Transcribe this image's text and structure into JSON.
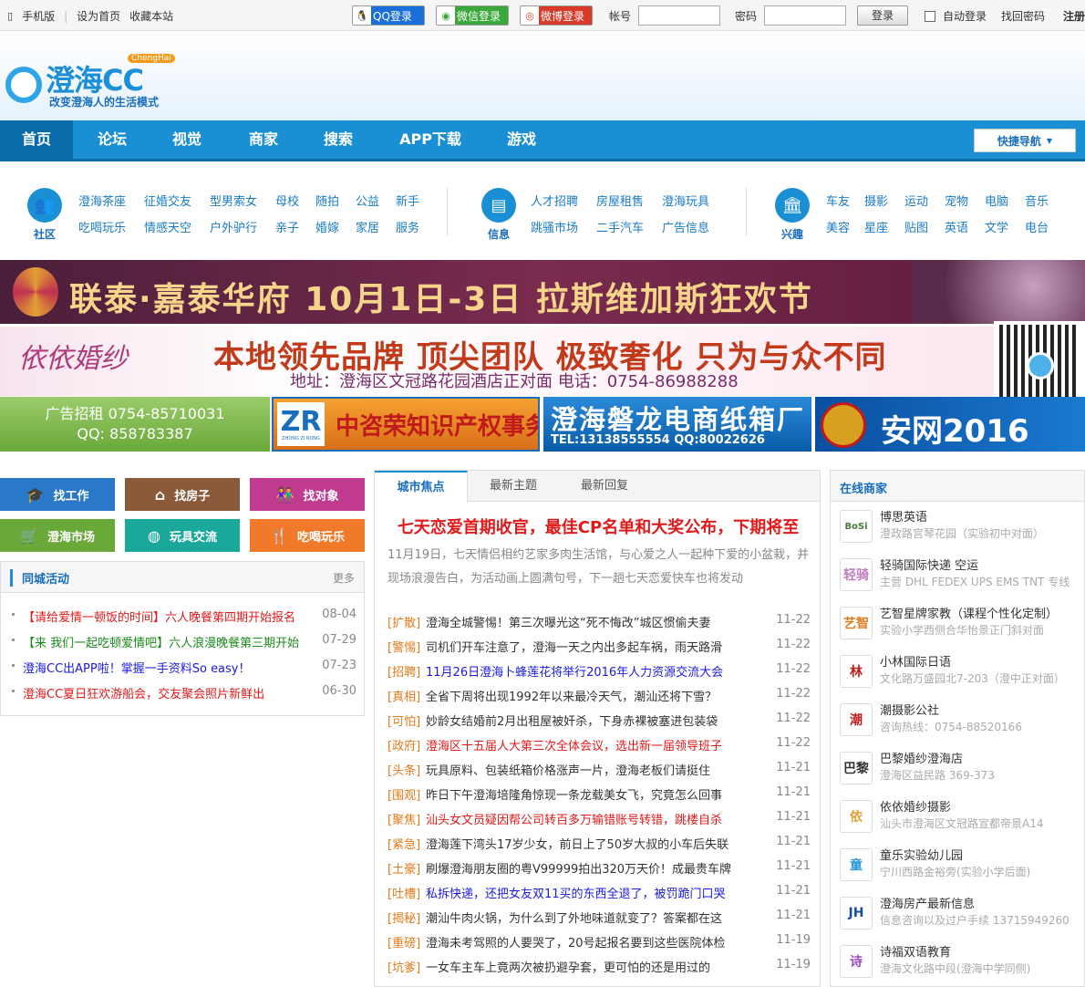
{
  "topbar": {
    "mobile": "手机版",
    "set_home": "设为首页",
    "bookmark": "收藏本站",
    "qq_login": "QQ登录",
    "wechat_login": "微信登录",
    "weibo_login": "微博登录",
    "account_label": "帐号",
    "password_label": "密码",
    "login_button": "登录",
    "auto_login": "自动登录",
    "forgot": "找回密码",
    "register": "注册"
  },
  "header": {
    "logo_text": "澄海CC",
    "logo_en": "ChengHai",
    "slogan": "改变澄海人的生活模式"
  },
  "nav": {
    "items": [
      "首页",
      "论坛",
      "视觉",
      "商家",
      "搜索",
      "APP下载",
      "游戏"
    ],
    "quick_nav": "快捷导航"
  },
  "categories": {
    "community": {
      "label": "社区",
      "links": [
        "澄海茶座",
        "征婚交友",
        "型男索女",
        "母校",
        "随拍",
        "公益",
        "新手",
        "吃喝玩乐",
        "情感天空",
        "户外驴行",
        "亲子",
        "婚嫁",
        "家居",
        "服务"
      ]
    },
    "info": {
      "label": "信息",
      "links": [
        "人才招聘",
        "房屋租售",
        "澄海玩具",
        "跳骚市场",
        "二手汽车",
        "广告信息"
      ]
    },
    "interest": {
      "label": "兴趣",
      "links": [
        "车友",
        "摄影",
        "运动",
        "宠物",
        "电脑",
        "音乐",
        "美容",
        "星座",
        "贴图",
        "英语",
        "文学",
        "电台"
      ]
    }
  },
  "banners": {
    "b1": "联泰·嘉泰华府  10月1日-3日  拉斯维加斯狂欢节",
    "b2_brand": "依依婚纱",
    "b2_main": "本地领先品牌  顶尖团队  极致奢化  只为与众不同",
    "b2_sub": "地址：澄海区文冠路花园酒店正对面   电话：0754-86988288",
    "ad1_line1": "广告招租 0754-85710031",
    "ad1_line2": "QQ: 858783387",
    "ad2_logo": "ZR",
    "ad2_logo_text": "ZHONG ZI RONG",
    "ad2_title": "中咨荣知识产权事务所",
    "ad3_title": "澄海磐龙电商纸箱厂",
    "ad3_sub": "TEL:13138555554   QQ:80022626",
    "ad4_title": "安网2016"
  },
  "tiles": [
    {
      "label": "找工作",
      "icon": "graduation-cap-icon",
      "glyph": "🎓",
      "color": "#2a78c8"
    },
    {
      "label": "找房子",
      "icon": "house-icon",
      "glyph": "⌂",
      "color": "#8a5a3a"
    },
    {
      "label": "找对象",
      "icon": "couple-icon",
      "glyph": "👫",
      "color": "#c03a90"
    },
    {
      "label": "澄海市场",
      "icon": "cart-icon",
      "glyph": "🛒",
      "color": "#6aa83a"
    },
    {
      "label": "玩具交流",
      "icon": "ball-icon",
      "glyph": "◍",
      "color": "#1aa89a"
    },
    {
      "label": "吃喝玩乐",
      "icon": "fork-knife-icon",
      "glyph": "🍴",
      "color": "#f07a2a"
    }
  ],
  "local_activity": {
    "title": "同城活动",
    "more": "更多",
    "items": [
      {
        "text": "【请给爱情一顿饭的时间】六人晚餐第四期开始报名",
        "date": "08-04",
        "color": "#e01a1a"
      },
      {
        "text": "【来 我们一起吃顿爱情吧】六人浪漫晚餐第三期开始",
        "date": "07-29",
        "color": "#1a8a1a"
      },
      {
        "text": "澄海CC出APP啦！掌握一手资料So easy！",
        "date": "07-23",
        "color": "#1a1ae0"
      },
      {
        "text": "澄海CC夏日狂欢游船会，交友聚会照片新鲜出",
        "date": "06-30",
        "color": "#e01a1a"
      }
    ]
  },
  "middle": {
    "tabs": [
      "城市焦点",
      "最新主题",
      "最新回复"
    ],
    "headline": "七天恋爱首期收官，最佳CP名单和大奖公布，下期将至",
    "summary": "11月19日，七天情侣相约艺家多肉生活馆，与心爱之人一起种下爱的小盆栽，并现场浪漫告白，为活动画上圆满句号，下一趟七天恋爱快车也将发动",
    "news": [
      {
        "tag": "[扩散]",
        "text": "澄海全城警惕！第三次曝光这“死不悔改”城区惯偷夫妻",
        "date": "11-22",
        "color": "#333"
      },
      {
        "tag": "[警惕]",
        "text": "司机们开车注意了，澄海一天之内出多起车祸，雨天路滑",
        "date": "11-22",
        "color": "#333"
      },
      {
        "tag": "[招聘]",
        "text": "11月26日澄海卜蜂莲花将举行2016年人力资源交流大会",
        "date": "11-22",
        "color": "#1a1ae0"
      },
      {
        "tag": "[真相]",
        "text": "全省下周将出现1992年以来最冷天气，潮汕还将下雪？",
        "date": "11-22",
        "color": "#333"
      },
      {
        "tag": "[可怕]",
        "text": "妙龄女结婚前2月出租屋被奸杀，下身赤裸被塞进包装袋",
        "date": "11-22",
        "color": "#333"
      },
      {
        "tag": "[政府]",
        "text": "澄海区十五届人大第三次全体会议，选出新一届领导班子",
        "date": "11-22",
        "color": "#e01a1a"
      },
      {
        "tag": "[头条]",
        "text": "玩具原料、包装纸箱价格涨声一片，澄海老板们请挺住",
        "date": "11-21",
        "color": "#333"
      },
      {
        "tag": "[围观]",
        "text": "昨日下午澄海培隆角惊现一条龙载美女飞，究竟怎么回事",
        "date": "11-21",
        "color": "#333"
      },
      {
        "tag": "[聚焦]",
        "text": "汕头女文员疑因帮公司转百多万输错账号转错，跳楼自杀",
        "date": "11-21",
        "color": "#e01a1a"
      },
      {
        "tag": "[紧急]",
        "text": "澄海莲下湾头17岁少女，前日上了50岁大叔的小车后失联",
        "date": "11-21",
        "color": "#333"
      },
      {
        "tag": "[土豪]",
        "text": "刷爆澄海朋友圈的粤V99999拍出320万天价！成最贵车牌",
        "date": "11-21",
        "color": "#333"
      },
      {
        "tag": "[吐槽]",
        "text": "私拆快递，还把女友双11买的东西全退了，被罚跪门口哭",
        "date": "11-21",
        "color": "#1a1ae0"
      },
      {
        "tag": "[揭秘]",
        "text": "潮汕牛肉火锅，为什么到了外地味道就变了？答案都在这",
        "date": "11-21",
        "color": "#333"
      },
      {
        "tag": "[重磅]",
        "text": "澄海未考驾照的人要哭了，20号起报名要到这些医院体检",
        "date": "11-19",
        "color": "#333"
      },
      {
        "tag": "[坑爹]",
        "text": "一女车主车上竟两次被扔避孕套，更可怕的还是用过的",
        "date": "11-19",
        "color": "#333"
      }
    ]
  },
  "merchants": {
    "title": "在线商家",
    "items": [
      {
        "name": "博思英语",
        "sub": "澄政路宫琴花园（实验初中对面）",
        "icon": "BoSi",
        "color": "#4a7a3a"
      },
      {
        "name": "轻骑国际快递 空运",
        "sub": "主营 DHL FEDEX UPS EMS TNT 专线",
        "icon": "轻骑",
        "color": "#c07ac0"
      },
      {
        "name": "艺智星牌家教（课程个性化定制）",
        "sub": "实验小学西侧合华怡景正门斜对面",
        "icon": "艺智",
        "color": "#e07a1a"
      },
      {
        "name": "小林国际日语",
        "sub": "文化路万盛园北7-203（澄中正对面）",
        "icon": "林",
        "color": "#c01a1a"
      },
      {
        "name": "潮摄影公社",
        "sub": "咨询热线：0754-88520166",
        "icon": "潮",
        "color": "#c01a1a"
      },
      {
        "name": "巴黎婚纱澄海店",
        "sub": "澄海区益民路 369-373",
        "icon": "巴黎",
        "color": "#333"
      },
      {
        "name": "依依婚纱摄影",
        "sub": "汕头市澄海区文冠路宣都帝景A14",
        "icon": "依",
        "color": "#e0a030"
      },
      {
        "name": "童乐实验幼儿园",
        "sub": "宁川西路金裕旁(实验小学后面)",
        "icon": "童",
        "color": "#2a9ad8"
      },
      {
        "name": "澄海房产最新信息",
        "sub": "信息咨询以及过户手续 13715949260",
        "icon": "JH",
        "color": "#1a4ea0"
      },
      {
        "name": "诗福双语教育",
        "sub": "澄海文化路中段(澄海中学同侧)",
        "icon": "诗",
        "color": "#9a4ac0"
      }
    ]
  }
}
